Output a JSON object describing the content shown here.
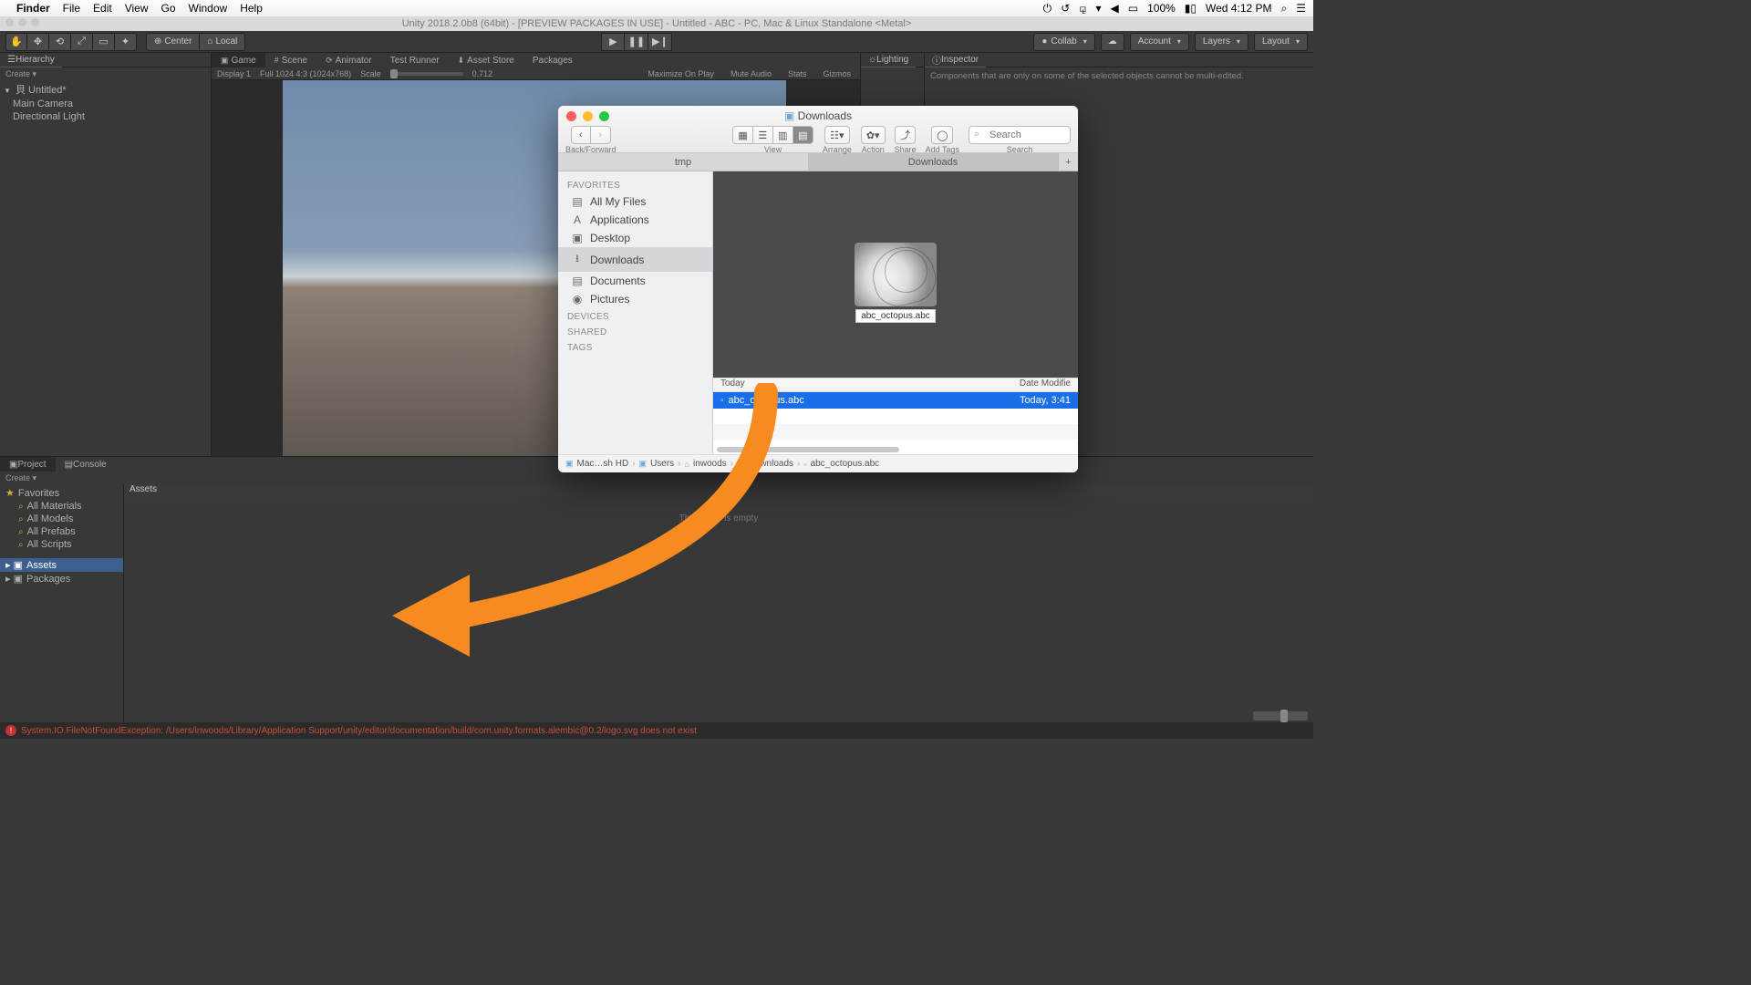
{
  "mac_menu": {
    "app": "Finder",
    "items": [
      "File",
      "Edit",
      "View",
      "Go",
      "Window",
      "Help"
    ],
    "battery": "100%",
    "clock": "Wed 4:12 PM"
  },
  "unity": {
    "title": "Unity 2018.2.0b8 (64bit) - [PREVIEW PACKAGES IN USE] - Untitled - ABC - PC, Mac & Linux Standalone <Metal>",
    "pivot": {
      "center": "Center",
      "local": "Local"
    },
    "right": {
      "collab": "Collab",
      "account": "Account",
      "layers": "Layers",
      "layout": "Layout"
    }
  },
  "hierarchy": {
    "tab": "Hierarchy",
    "create": "Create ▾",
    "scene": "Untitled*",
    "items": [
      "Main Camera",
      "Directional Light"
    ]
  },
  "center": {
    "tabs": [
      "Game",
      "Scene",
      "Animator",
      "Test Runner",
      "Asset Store",
      "Packages"
    ],
    "display": "Display 1",
    "res": "Full 1024 4:3 (1024x768)",
    "scale_label": "Scale",
    "scale_value": "0.712",
    "right_pills": [
      "Maximize On Play",
      "Mute Audio",
      "Stats",
      "Gizmos"
    ]
  },
  "lighting": {
    "tab": "Lighting"
  },
  "inspector": {
    "tab": "Inspector",
    "msg": "Components that are only on some of the selected objects cannot be multi-edited."
  },
  "project": {
    "tabs": [
      "Project",
      "Console"
    ],
    "create": "Create ▾",
    "favorites": "Favorites",
    "fav_items": [
      "All Materials",
      "All Models",
      "All Prefabs",
      "All Scripts"
    ],
    "assets": "Assets",
    "packages": "Packages",
    "path": "Assets",
    "empty": "This folder is empty"
  },
  "status": {
    "error": "System.IO.FileNotFoundException: /Users/inwoods/Library/Application Support/unity/editor/documentation/build/com.unity.formats.alembic@0.2/logo.svg does not exist"
  },
  "finder": {
    "title": "Downloads",
    "toolbar": {
      "back_label": "Back/Forward",
      "view_label": "View",
      "arrange_label": "Arrange",
      "action_label": "Action",
      "share_label": "Share",
      "tags_label": "Add Tags",
      "search_label": "Search",
      "search_placeholder": "Search"
    },
    "tabs": {
      "inactive": "tmp",
      "active": "Downloads"
    },
    "sidebar": {
      "favorites": "Favorites",
      "items": [
        {
          "icon": "▤",
          "label": "All My Files"
        },
        {
          "icon": "A",
          "label": "Applications"
        },
        {
          "icon": "▣",
          "label": "Desktop"
        },
        {
          "icon": "⭳",
          "label": "Downloads",
          "selected": true
        },
        {
          "icon": "▤",
          "label": "Documents"
        },
        {
          "icon": "◉",
          "label": "Pictures"
        }
      ],
      "devices": "Devices",
      "shared": "Shared",
      "tags": "Tags"
    },
    "preview_label": "abc_octopus.abc",
    "list": {
      "col_today": "Today",
      "col_modified": "Date Modifie",
      "file_name": "abc_octopus.abc",
      "file_date": "Today, 3:41"
    },
    "path": [
      "Mac…sh HD",
      "Users",
      "inwoods",
      "Downloads",
      "abc_octopus.abc"
    ]
  }
}
